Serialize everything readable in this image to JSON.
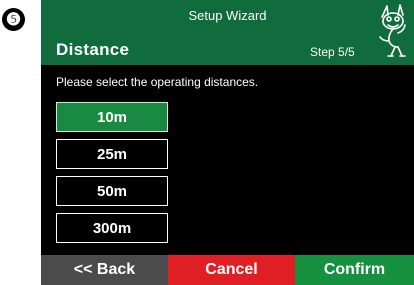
{
  "step_marker": "❺",
  "header": {
    "app_title": "Setup Wizard",
    "page_title": "Distance",
    "step": "Step 5/5",
    "logo_icon": "mascot-icon"
  },
  "instruction": "Please select the operating distances.",
  "options": [
    {
      "label": "10m",
      "selected": true
    },
    {
      "label": "25m",
      "selected": false
    },
    {
      "label": "50m",
      "selected": false
    },
    {
      "label": "300m",
      "selected": false
    }
  ],
  "footer": {
    "back_label": "<< Back",
    "cancel_label": "Cancel",
    "confirm_label": "Confirm"
  },
  "colors": {
    "header": "#106c3c",
    "selected": "#1a8a42",
    "back": "#4b4b4b",
    "cancel": "#e01f24",
    "confirm": "#15913f"
  }
}
